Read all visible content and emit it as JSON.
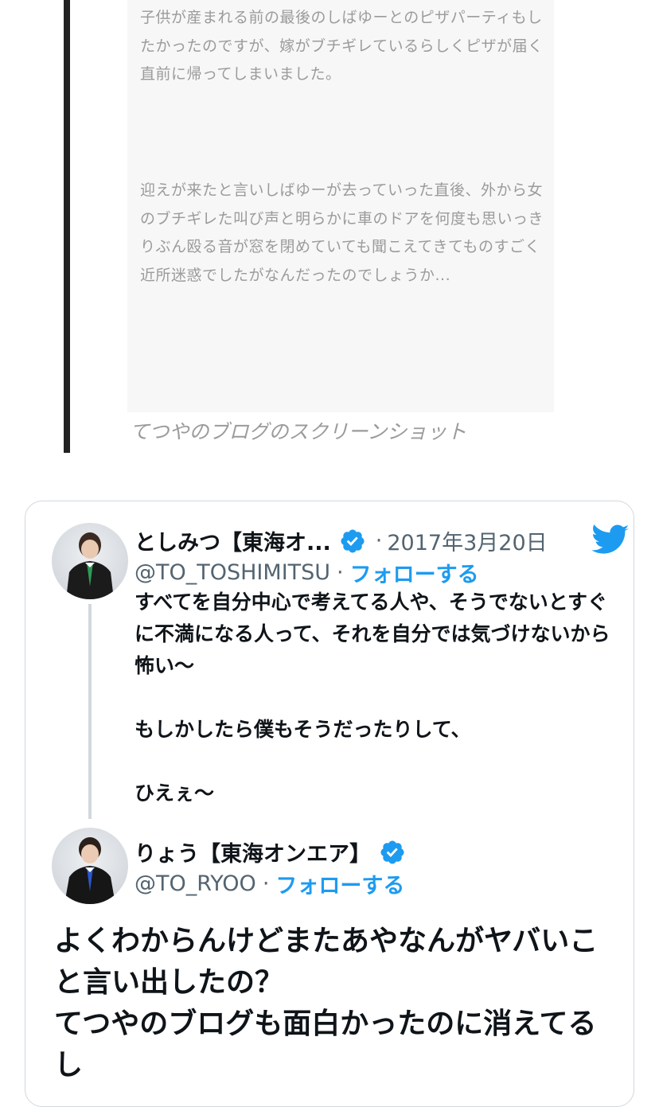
{
  "blog_screenshot": {
    "paragraph_1": "子供が産まれる前の最後のしばゆーとのピザパーティもしたかったのですが、嫁がブチギレているらしくピザが届く直前に帰ってしまいました。",
    "paragraph_2": "迎えが来たと言いしばゆーが去っていった直後、外から女のブチギレた叫び声と明らかに車のドアを何度も思いっきりぶん殴る音が窓を閉めていても聞こえてきてものすごく近所迷惑でしたがなんだったのでしょうか...",
    "caption": "てつやのブログのスクリーンショット"
  },
  "embed": {
    "original_tweet": {
      "display_name": "としみつ【東海オ...",
      "verified": true,
      "separator": "·",
      "date": "2017年3月20日",
      "handle": "@TO_TOSHIMITSU",
      "follow_label": "フォローする",
      "text": "すべてを自分中心で考えてる人や、そうでないとすぐに不満になる人って、それを自分では気づけないから怖い〜\n\nもしかしたら僕もそうだったりして、\n\nひえぇ〜"
    },
    "reply_tweet": {
      "display_name": "りょう【東海オンエア】",
      "verified": true,
      "handle": "@TO_RYOO",
      "follow_label": "フォローする",
      "text": "よくわからんけどまたあやなんがヤバいこと言い出したの？\nてつやのブログも面白かったのに消えてるし"
    },
    "icons": {
      "verified": "verified-badge-icon",
      "brand": "twitter-bird-icon"
    },
    "colors": {
      "link_blue": "#1d9bf0",
      "muted_gray": "#536471",
      "border": "#cfd9de"
    }
  }
}
